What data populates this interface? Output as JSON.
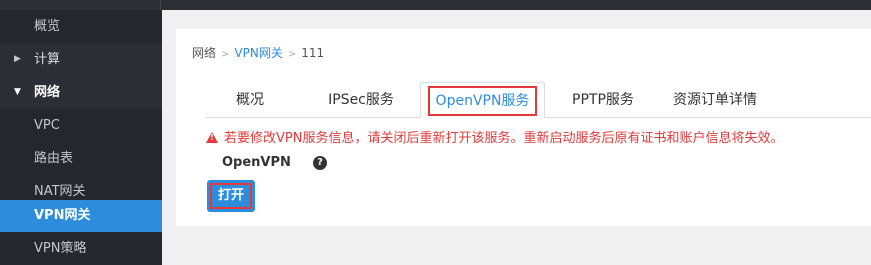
{
  "sidebar": {
    "items": [
      {
        "label": "概览",
        "kind": "sub"
      },
      {
        "label": "计算",
        "kind": "top",
        "expanded": false
      },
      {
        "label": "网络",
        "kind": "top",
        "expanded": true
      },
      {
        "label": "VPC",
        "kind": "sub"
      },
      {
        "label": "路由表",
        "kind": "sub"
      },
      {
        "label": "NAT网关",
        "kind": "sub"
      },
      {
        "label": "VPN网关",
        "kind": "sub",
        "active": true
      },
      {
        "label": "VPN策略",
        "kind": "sub"
      }
    ]
  },
  "breadcrumb": {
    "root": "网络",
    "parent": "VPN网关",
    "current": "111"
  },
  "tabs": [
    {
      "label": "概况",
      "active": false
    },
    {
      "label": "IPSec服务",
      "active": false
    },
    {
      "label": "OpenVPN服务",
      "active": true
    },
    {
      "label": "PPTP服务",
      "active": false
    },
    {
      "label": "资源订单详情",
      "active": false
    }
  ],
  "warning": {
    "text": "若要修改VPN服务信息，请关闭后重新打开该服务。重新启动服务后原有证书和账户信息将失效。"
  },
  "openvpn": {
    "label": "OpenVPN",
    "help_icon": "question-circle-icon",
    "button_label": "打开"
  },
  "colors": {
    "accent": "#2d8cdc",
    "highlight": "#e23a3a",
    "sidebar_bg": "#2b2e35"
  }
}
